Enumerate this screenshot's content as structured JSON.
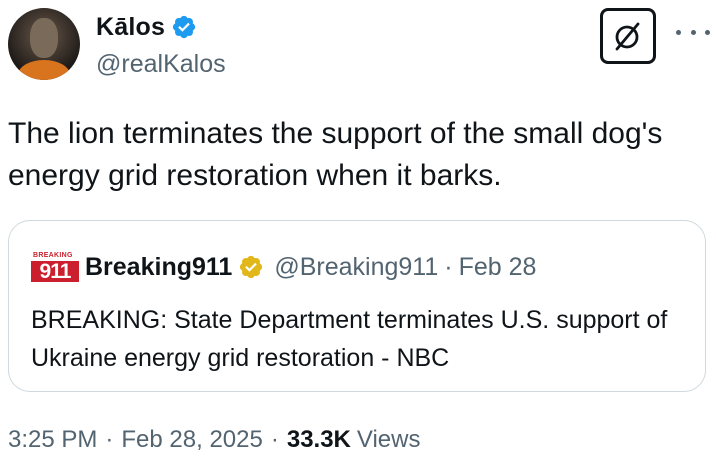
{
  "author": {
    "display_name": "Kālos",
    "handle": "@realKalos",
    "verified_badge_color": "#1d9bf0"
  },
  "actions": {
    "grok_icon": "slashed-circle-icon",
    "more_icon": "ellipsis-icon"
  },
  "tweet": {
    "text": "The lion terminates the support of the small dog's energy grid restoration when it barks."
  },
  "quoted_tweet": {
    "logo_small_text": "BREAKING",
    "logo_number": "911",
    "display_name": "Breaking911",
    "handle": "@Breaking911",
    "separator": "·",
    "date": "Feb 28",
    "text": "BREAKING: State Department terminates U.S. support of Ukraine energy grid restoration - NBC",
    "badge_color": "#e2b719",
    "logo_color": "#cc1f2d"
  },
  "meta": {
    "time": "3:25 PM",
    "separator": "·",
    "date": "Feb 28, 2025",
    "views_count": "33.3K",
    "views_label": "Views"
  }
}
